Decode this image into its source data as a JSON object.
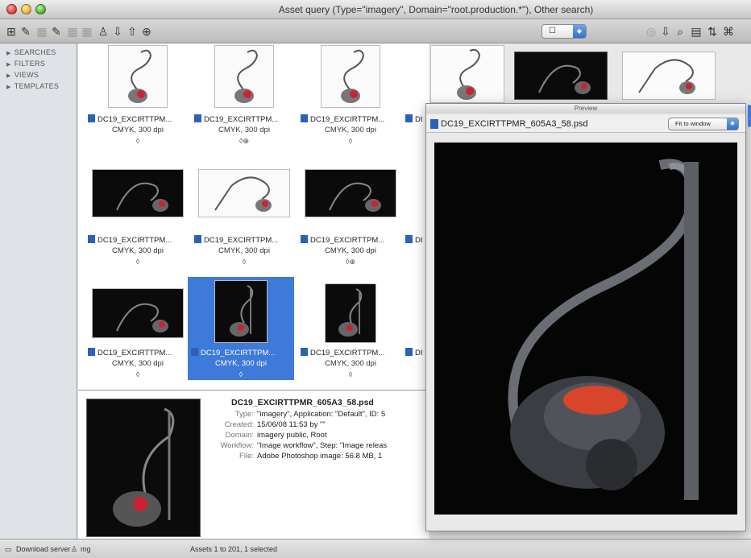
{
  "window": {
    "title": "Asset query (Type=\"imagery\", Domain=\"root.production.*\"), Other search)"
  },
  "toolbar": {
    "left_icons": [
      "new-asset-icon",
      "import-icon",
      "delete-icon",
      "copy-icon",
      "move-icon",
      "paste-icon",
      "user-icon",
      "checkout-icon",
      "checkin-icon",
      "zoom-icon"
    ],
    "view_select_value": "☐",
    "right_icons": [
      "refresh-icon",
      "download-icon",
      "search-icon",
      "filter-icon",
      "sort-icon",
      "link-icon"
    ]
  },
  "sidebar": {
    "items": [
      {
        "label": "SEARCHES"
      },
      {
        "label": "FILTERS"
      },
      {
        "label": "VIEWS"
      },
      {
        "label": "TEMPLATES"
      }
    ]
  },
  "grid": {
    "cells": [
      {
        "name": "DC19_EXCIRTTPM...",
        "format": "CMYK, 300 dpi",
        "status": "◊",
        "theme": "light",
        "selected": false
      },
      {
        "name": "DC19_EXCIRTTPM...",
        "format": "CMYK, 300 dpi",
        "status": "◊⊕",
        "theme": "light",
        "selected": false
      },
      {
        "name": "DC19_EXCIRTTPM...",
        "format": "CMYK, 300 dpi",
        "status": "◊",
        "theme": "light",
        "selected": false
      },
      {
        "name": "DC19_EXCIRTTPM...",
        "format": "CMYK, 300 dpi",
        "status": "◊",
        "theme": "dark",
        "selected": false
      },
      {
        "name": "DC19_EXCIRTTPM...",
        "format": "CMYK, 300 dpi",
        "status": "◊",
        "theme": "light",
        "selected": false
      },
      {
        "name": "DC19_EXCIRTTPM...",
        "format": "CMYK, 300 dpi",
        "status": "◊⊕",
        "theme": "dark",
        "selected": false
      },
      {
        "name": "DC19_EXCIRTTPM...",
        "format": "CMYK, 300 dpi",
        "status": "◊",
        "theme": "dark",
        "selected": false
      },
      {
        "name": "DC19_EXCIRTTPM...",
        "format": "CMYK, 300 dpi",
        "status": "◊",
        "theme": "dark",
        "selected": true
      },
      {
        "name": "DC19_EXCIRTTPM...",
        "format": "CMYK, 300 dpi",
        "status": "◊",
        "theme": "dark",
        "selected": false
      }
    ],
    "partial_col_labels": [
      "DI",
      "DI",
      "DI",
      "DI"
    ]
  },
  "detail": {
    "title": "DC19_EXCIRTTPMR_605A3_58.psd",
    "rows": [
      {
        "key": "Type:",
        "value": "\"imagery\", Application: \"Default\", ID: 5"
      },
      {
        "key": "Created:",
        "value": "15/06/08  11:53 by \"\""
      },
      {
        "key": "Domain:",
        "value": "imagery public, Root"
      },
      {
        "key": "Workflow:",
        "value": "\"Image workflow\", Step: \"Image releas"
      },
      {
        "key": "File:",
        "value": "Adobe Photoshop image: 56.8 MB, 1"
      }
    ]
  },
  "preview": {
    "header": "Preview",
    "filename": "DC19_EXCIRTTPMR_605A3_58.psd",
    "fit_select": "Fit to window"
  },
  "status": {
    "download": "Download server",
    "user": "mg",
    "assets": "Assets 1 to 201, 1 selected"
  }
}
